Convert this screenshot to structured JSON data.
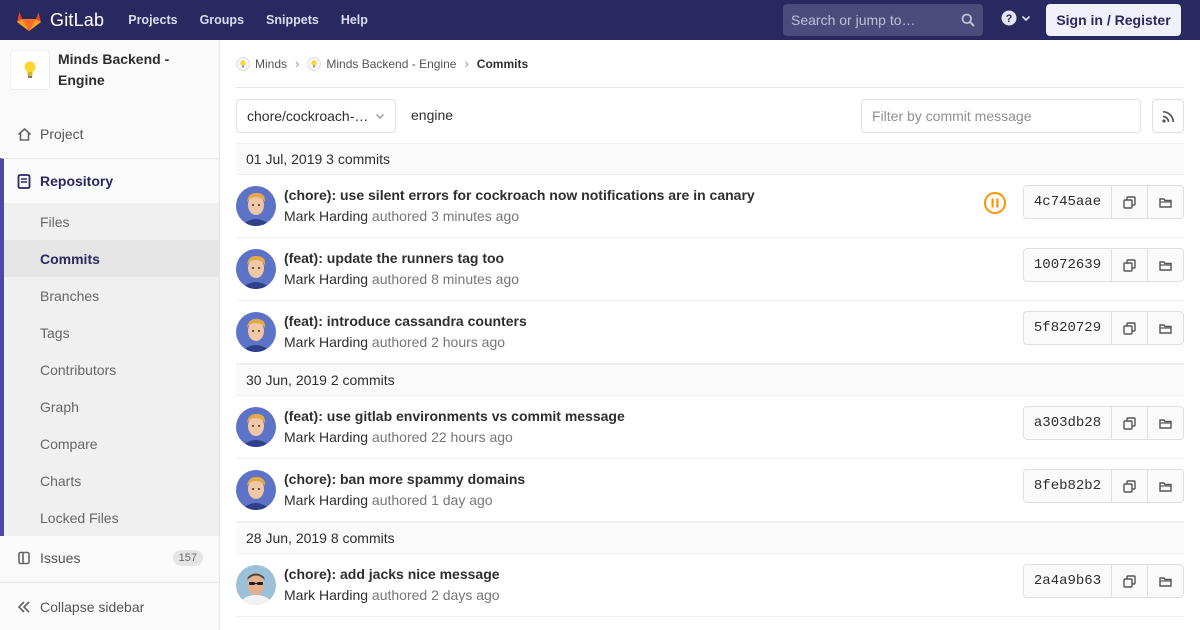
{
  "navbar": {
    "brand": "GitLab",
    "links": [
      "Projects",
      "Groups",
      "Snippets",
      "Help"
    ],
    "search_placeholder": "Search or jump to…",
    "signin_label": "Sign in / Register"
  },
  "sidebar": {
    "project_name": "Minds Backend - Engine",
    "project_label": "Project",
    "repository_label": "Repository",
    "repo_items": [
      "Files",
      "Commits",
      "Branches",
      "Tags",
      "Contributors",
      "Graph",
      "Compare",
      "Charts",
      "Locked Files"
    ],
    "active_repo_item": "Commits",
    "issues_label": "Issues",
    "issues_count": "157",
    "collapse_label": "Collapse sidebar"
  },
  "breadcrumbs": [
    "Minds",
    "Minds Backend - Engine",
    "Commits"
  ],
  "toolbar": {
    "branch": "chore/cockroach-…",
    "path": "engine",
    "filter_placeholder": "Filter by commit message"
  },
  "commit_groups": [
    {
      "date": "01 Jul, 2019 3 commits",
      "commits": [
        {
          "title": "(chore): use silent errors for cockroach now notifications are in canary",
          "author": "Mark Harding",
          "authored": "authored",
          "time": "3 minutes ago",
          "sha": "4c745aae",
          "avatar": "mark",
          "status": "paused"
        },
        {
          "title": "(feat): update the runners tag too",
          "author": "Mark Harding",
          "authored": "authored",
          "time": "8 minutes ago",
          "sha": "10072639",
          "avatar": "mark",
          "status": ""
        },
        {
          "title": "(feat): introduce cassandra counters",
          "author": "Mark Harding",
          "authored": "authored",
          "time": "2 hours ago",
          "sha": "5f820729",
          "avatar": "mark",
          "status": ""
        }
      ]
    },
    {
      "date": "30 Jun, 2019 2 commits",
      "commits": [
        {
          "title": "(feat): use gitlab environments vs commit message",
          "author": "Mark Harding",
          "authored": "authored",
          "time": "22 hours ago",
          "sha": "a303db28",
          "avatar": "mark",
          "status": ""
        },
        {
          "title": "(chore): ban more spammy domains",
          "author": "Mark Harding",
          "authored": "authored",
          "time": "1 day ago",
          "sha": "8feb82b2",
          "avatar": "mark",
          "status": ""
        }
      ]
    },
    {
      "date": "28 Jun, 2019 8 commits",
      "commits": [
        {
          "title": "(chore): add jacks nice message",
          "author": "Mark Harding",
          "authored": "authored",
          "time": "2 days ago",
          "sha": "2a4a9b63",
          "avatar": "jack",
          "status": ""
        }
      ]
    }
  ],
  "colors": {
    "navbar": "#292961",
    "accent": "#4b4ba3",
    "status_paused": "#fc9403"
  }
}
